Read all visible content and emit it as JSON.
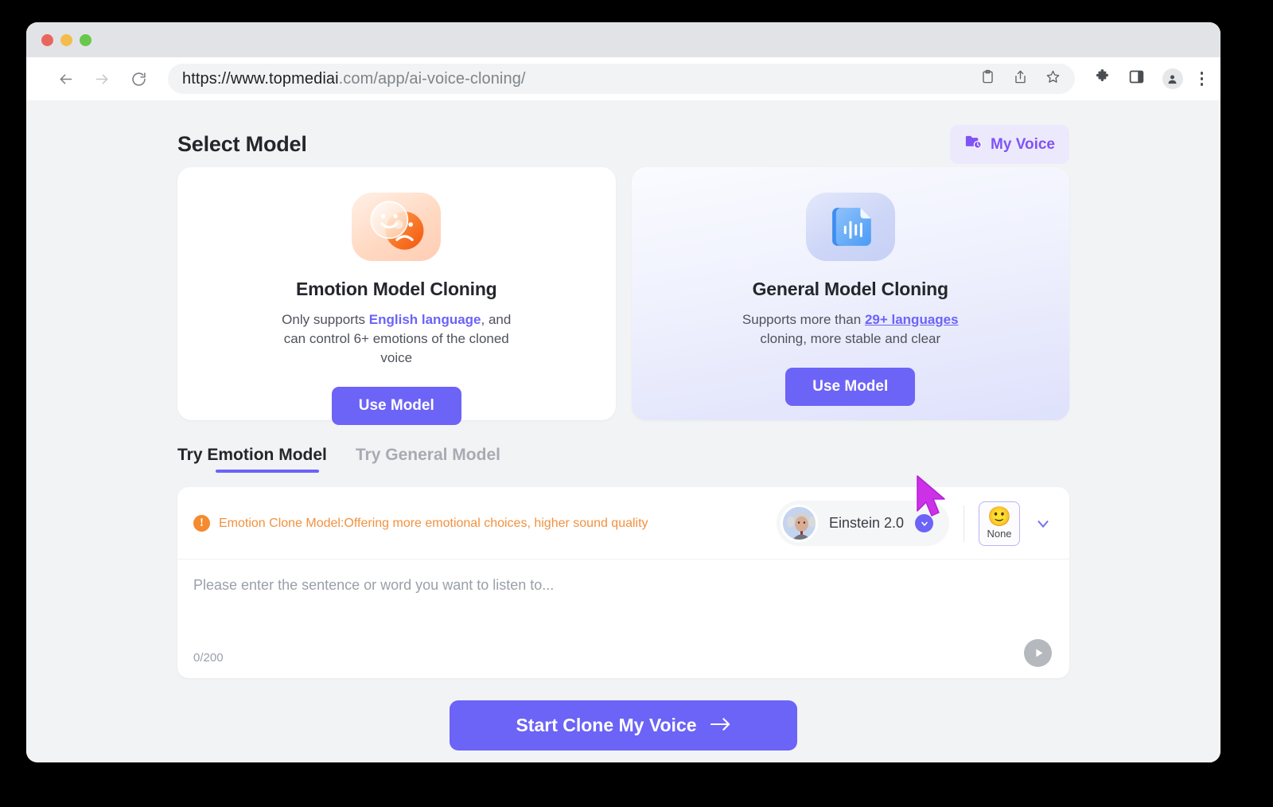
{
  "browser": {
    "url_strong": "https://www.topmediai",
    "url_dim": ".com/app/ai-voice-cloning/",
    "back_icon": "back-arrow-icon",
    "forward_icon": "forward-arrow-icon",
    "reload_icon": "reload-icon",
    "clipboard_icon": "clipboard-icon",
    "share_icon": "share-icon",
    "bookmark_icon": "star-icon",
    "extensions_icon": "puzzle-icon",
    "sidepanel_icon": "side-panel-icon",
    "profile_icon": "profile-avatar-icon",
    "menu_icon": "kebab-menu-icon"
  },
  "header": {
    "title": "Select Model",
    "my_voice_label": "My Voice",
    "my_voice_icon": "folder-clock-icon"
  },
  "cards": [
    {
      "id": "emotion",
      "icon": "emotion-faces-icon",
      "title": "Emotion Model Cloning",
      "desc_prefix": "Only supports ",
      "desc_link": "English language",
      "desc_suffix": ", and can control 6+ emotions of the cloned voice",
      "button_label": "Use Model"
    },
    {
      "id": "general",
      "icon": "audio-document-icon",
      "title": "General Model Cloning",
      "desc_prefix": "Supports more than ",
      "desc_link": "29+ languages",
      "desc_suffix": " cloning, more stable and clear",
      "button_label": "Use Model"
    }
  ],
  "tabs": [
    {
      "try_word": "Try",
      "label": "Emotion Model",
      "active": true
    },
    {
      "try_word": "Try",
      "label": "General Model",
      "active": false
    }
  ],
  "editor": {
    "notice_icon": "warning-circle-icon",
    "notice_text": "Emotion Clone Model:Offering more emotional choices, higher sound quality",
    "voice_name": "Einstein 2.0",
    "voice_avatar": "einstein-portrait-avatar",
    "voice_chevron_icon": "chevron-down-icon",
    "emotion_emoji": "🙂",
    "emotion_label": "None",
    "emotion_chevron_icon": "chevron-down-icon",
    "placeholder": "Please enter the sentence or word you want to listen to...",
    "counter": "0/200",
    "play_icon": "play-icon"
  },
  "cta": {
    "label": "Start Clone My Voice",
    "arrow_icon": "arrow-right-icon"
  },
  "colors": {
    "accent": "#6c63f7",
    "notice": "#f3913f",
    "cursor": "#cc31e8",
    "page_bg": "#f2f3f5"
  }
}
